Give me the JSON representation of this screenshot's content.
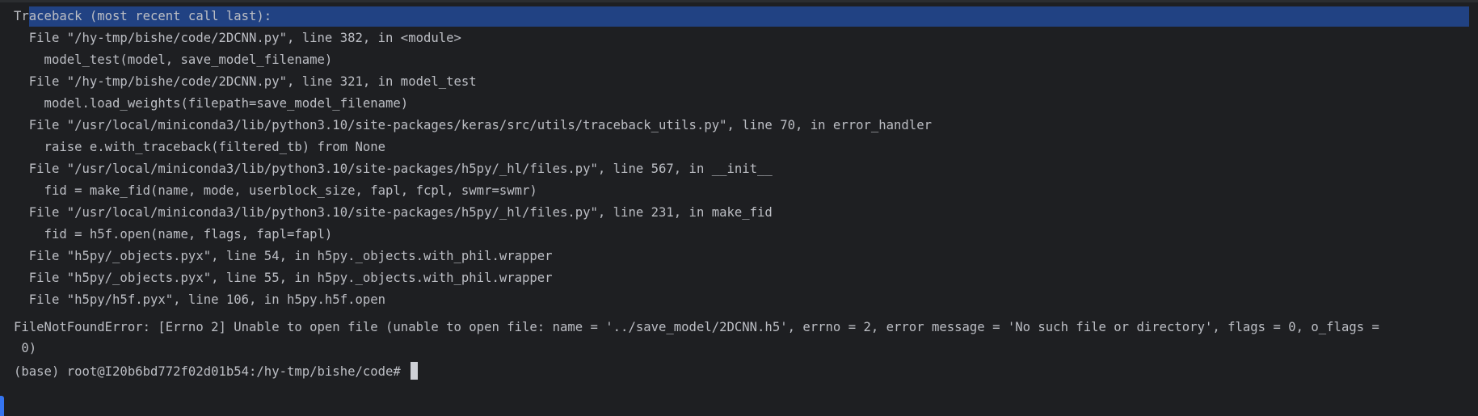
{
  "terminal": {
    "lines": [
      "Traceback (most recent call last):",
      "  File \"/hy-tmp/bishe/code/2DCNN.py\", line 382, in <module>",
      "    model_test(model, save_model_filename)",
      "  File \"/hy-tmp/bishe/code/2DCNN.py\", line 321, in model_test",
      "    model.load_weights(filepath=save_model_filename)",
      "  File \"/usr/local/miniconda3/lib/python3.10/site-packages/keras/src/utils/traceback_utils.py\", line 70, in error_handler",
      "    raise e.with_traceback(filtered_tb) from None",
      "  File \"/usr/local/miniconda3/lib/python3.10/site-packages/h5py/_hl/files.py\", line 567, in __init__",
      "    fid = make_fid(name, mode, userblock_size, fapl, fcpl, swmr=swmr)",
      "  File \"/usr/local/miniconda3/lib/python3.10/site-packages/h5py/_hl/files.py\", line 231, in make_fid",
      "    fid = h5f.open(name, flags, fapl=fapl)",
      "  File \"h5py/_objects.pyx\", line 54, in h5py._objects.with_phil.wrapper",
      "  File \"h5py/_objects.pyx\", line 55, in h5py._objects.with_phil.wrapper",
      "  File \"h5py/h5f.pyx\", line 106, in h5py.h5f.open",
      "FileNotFoundError: [Errno 2] Unable to open file (unable to open file: name = '../save_model/2DCNN.h5', errno = 2, error message = 'No such file or directory', flags = 0, o_flags =",
      " 0)"
    ],
    "prompt": "(base) root@I20b6bd772f02d01b54:/hy-tmp/bishe/code#"
  }
}
